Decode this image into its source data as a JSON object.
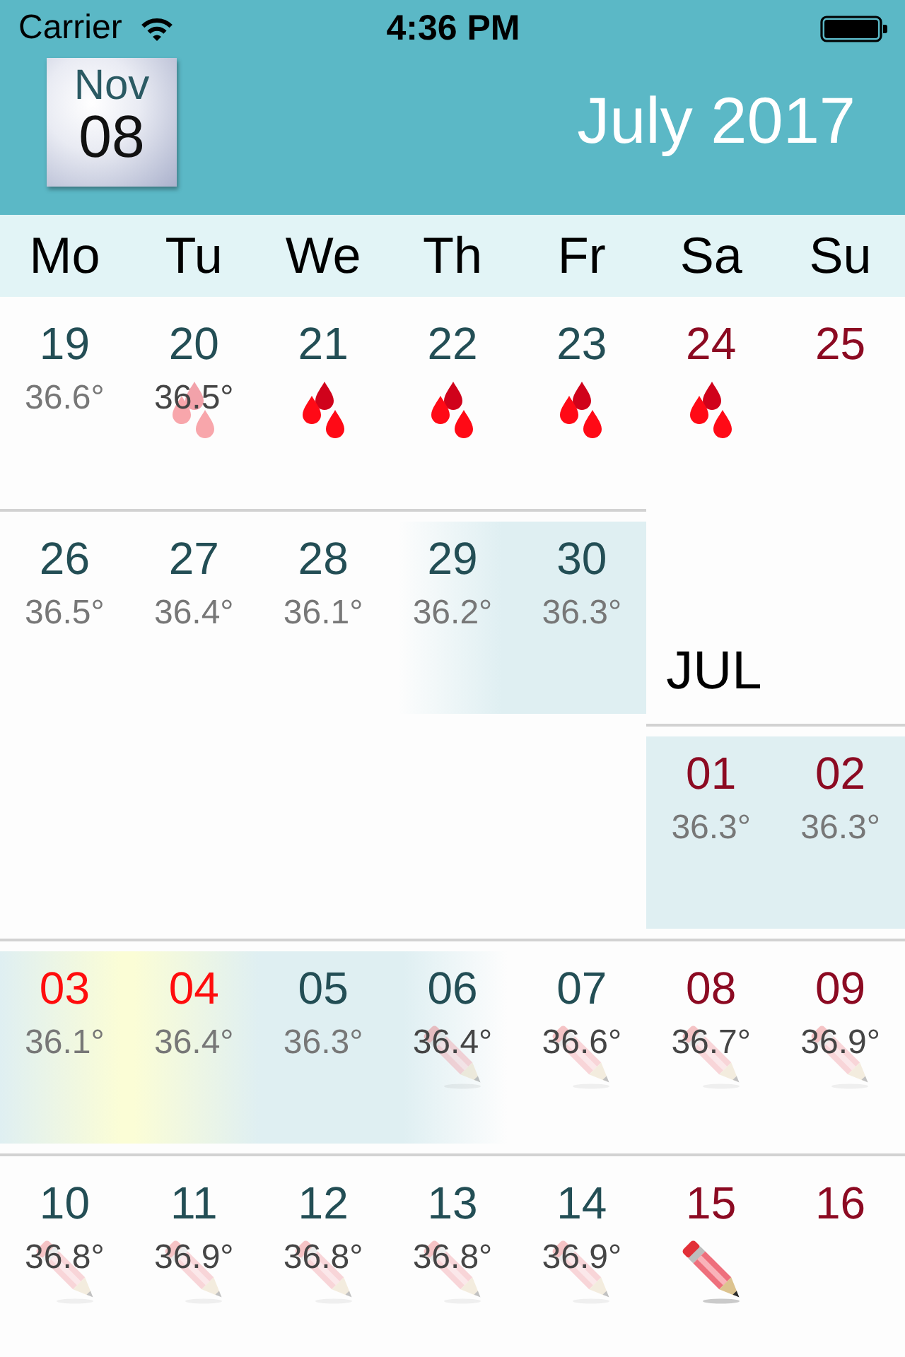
{
  "status_bar": {
    "carrier": "Carrier",
    "time": "4:36 PM"
  },
  "header": {
    "today": {
      "month": "Nov",
      "day": "08"
    },
    "title": "July 2017"
  },
  "weekdays": [
    "Mo",
    "Tu",
    "We",
    "Th",
    "Fr",
    "Sa",
    "Su"
  ],
  "weeks": [
    {
      "segments": [
        {
          "days": [
            {
              "number": "19",
              "temp": "36.6°",
              "color": "#234e55",
              "shaded": false,
              "peak": false
            },
            {
              "number": "20",
              "temp": "36.5°",
              "color": "#234e55",
              "shaded": false,
              "peak": false,
              "marker": {
                "kind": "drops",
                "faded": true
              }
            },
            {
              "number": "21",
              "color": "#234e55",
              "shaded": false,
              "peak": false,
              "marker": {
                "kind": "drops",
                "faded": false
              }
            },
            {
              "number": "22",
              "color": "#234e55",
              "shaded": false,
              "peak": false,
              "marker": {
                "kind": "drops",
                "faded": false
              }
            },
            {
              "number": "23",
              "color": "#234e55",
              "shaded": false,
              "peak": false,
              "marker": {
                "kind": "drops",
                "faded": false
              }
            },
            {
              "number": "24",
              "color": "#8c0a22",
              "shaded": false,
              "peak": false,
              "marker": {
                "kind": "drops",
                "faded": false
              }
            },
            {
              "number": "25",
              "color": "#8c0a22",
              "shaded": false,
              "peak": false
            }
          ]
        }
      ]
    },
    {
      "segments": [
        {
          "days": [
            {
              "number": "26",
              "temp": "36.5°",
              "color": "#234e55",
              "shaded": false,
              "peak": false
            },
            {
              "number": "27",
              "temp": "36.4°",
              "color": "#234e55",
              "shaded": false,
              "peak": false
            },
            {
              "number": "28",
              "temp": "36.1°",
              "color": "#234e55",
              "shaded": false,
              "peak": false
            },
            {
              "number": "29",
              "temp": "36.2°",
              "color": "#234e55",
              "shaded": true,
              "peak": false
            },
            {
              "number": "30",
              "temp": "36.3°",
              "color": "#234e55",
              "shaded": true,
              "peak": false
            }
          ]
        },
        {
          "label": "JUL",
          "days": [
            {
              "number": "01",
              "temp": "36.3°",
              "color": "#8c0a22",
              "shaded": true,
              "peak": false
            },
            {
              "number": "02",
              "temp": "36.3°",
              "color": "#8c0a22",
              "shaded": true,
              "peak": false
            }
          ]
        }
      ]
    },
    {
      "segments": [
        {
          "days": [
            {
              "number": "03",
              "temp": "36.1°",
              "color": "#ff0d0d",
              "shaded": true,
              "peak": false
            },
            {
              "number": "04",
              "temp": "36.4°",
              "color": "#ff0d0d",
              "shaded": true,
              "peak": true
            },
            {
              "number": "05",
              "temp": "36.3°",
              "color": "#234e55",
              "shaded": true,
              "peak": false
            },
            {
              "number": "06",
              "temp": "36.4°",
              "color": "#234e55",
              "shaded": true,
              "peak": false,
              "marker": {
                "kind": "pencil",
                "faded": true
              }
            },
            {
              "number": "07",
              "temp": "36.6°",
              "color": "#234e55",
              "shaded": false,
              "peak": false,
              "marker": {
                "kind": "pencil",
                "faded": true
              }
            },
            {
              "number": "08",
              "temp": "36.7°",
              "color": "#8c0a22",
              "shaded": false,
              "peak": false,
              "marker": {
                "kind": "pencil",
                "faded": true
              }
            },
            {
              "number": "09",
              "temp": "36.9°",
              "color": "#8c0a22",
              "shaded": false,
              "peak": false,
              "marker": {
                "kind": "pencil",
                "faded": true
              }
            }
          ]
        }
      ]
    },
    {
      "segments": [
        {
          "days": [
            {
              "number": "10",
              "temp": "36.8°",
              "color": "#234e55",
              "shaded": false,
              "peak": false,
              "marker": {
                "kind": "pencil",
                "faded": true
              }
            },
            {
              "number": "11",
              "temp": "36.9°",
              "color": "#234e55",
              "shaded": false,
              "peak": false,
              "marker": {
                "kind": "pencil",
                "faded": true
              }
            },
            {
              "number": "12",
              "temp": "36.8°",
              "color": "#234e55",
              "shaded": false,
              "peak": false,
              "marker": {
                "kind": "pencil",
                "faded": true
              }
            },
            {
              "number": "13",
              "temp": "36.8°",
              "color": "#234e55",
              "shaded": false,
              "peak": false,
              "marker": {
                "kind": "pencil",
                "faded": true
              }
            },
            {
              "number": "14",
              "temp": "36.9°",
              "color": "#234e55",
              "shaded": false,
              "peak": false,
              "marker": {
                "kind": "pencil",
                "faded": true
              }
            },
            {
              "number": "15",
              "color": "#8c0a22",
              "shaded": false,
              "peak": false,
              "marker": {
                "kind": "pencil",
                "faded": false
              }
            },
            {
              "number": "16",
              "color": "#8c0a22",
              "shaded": false,
              "peak": false
            }
          ]
        }
      ]
    }
  ]
}
